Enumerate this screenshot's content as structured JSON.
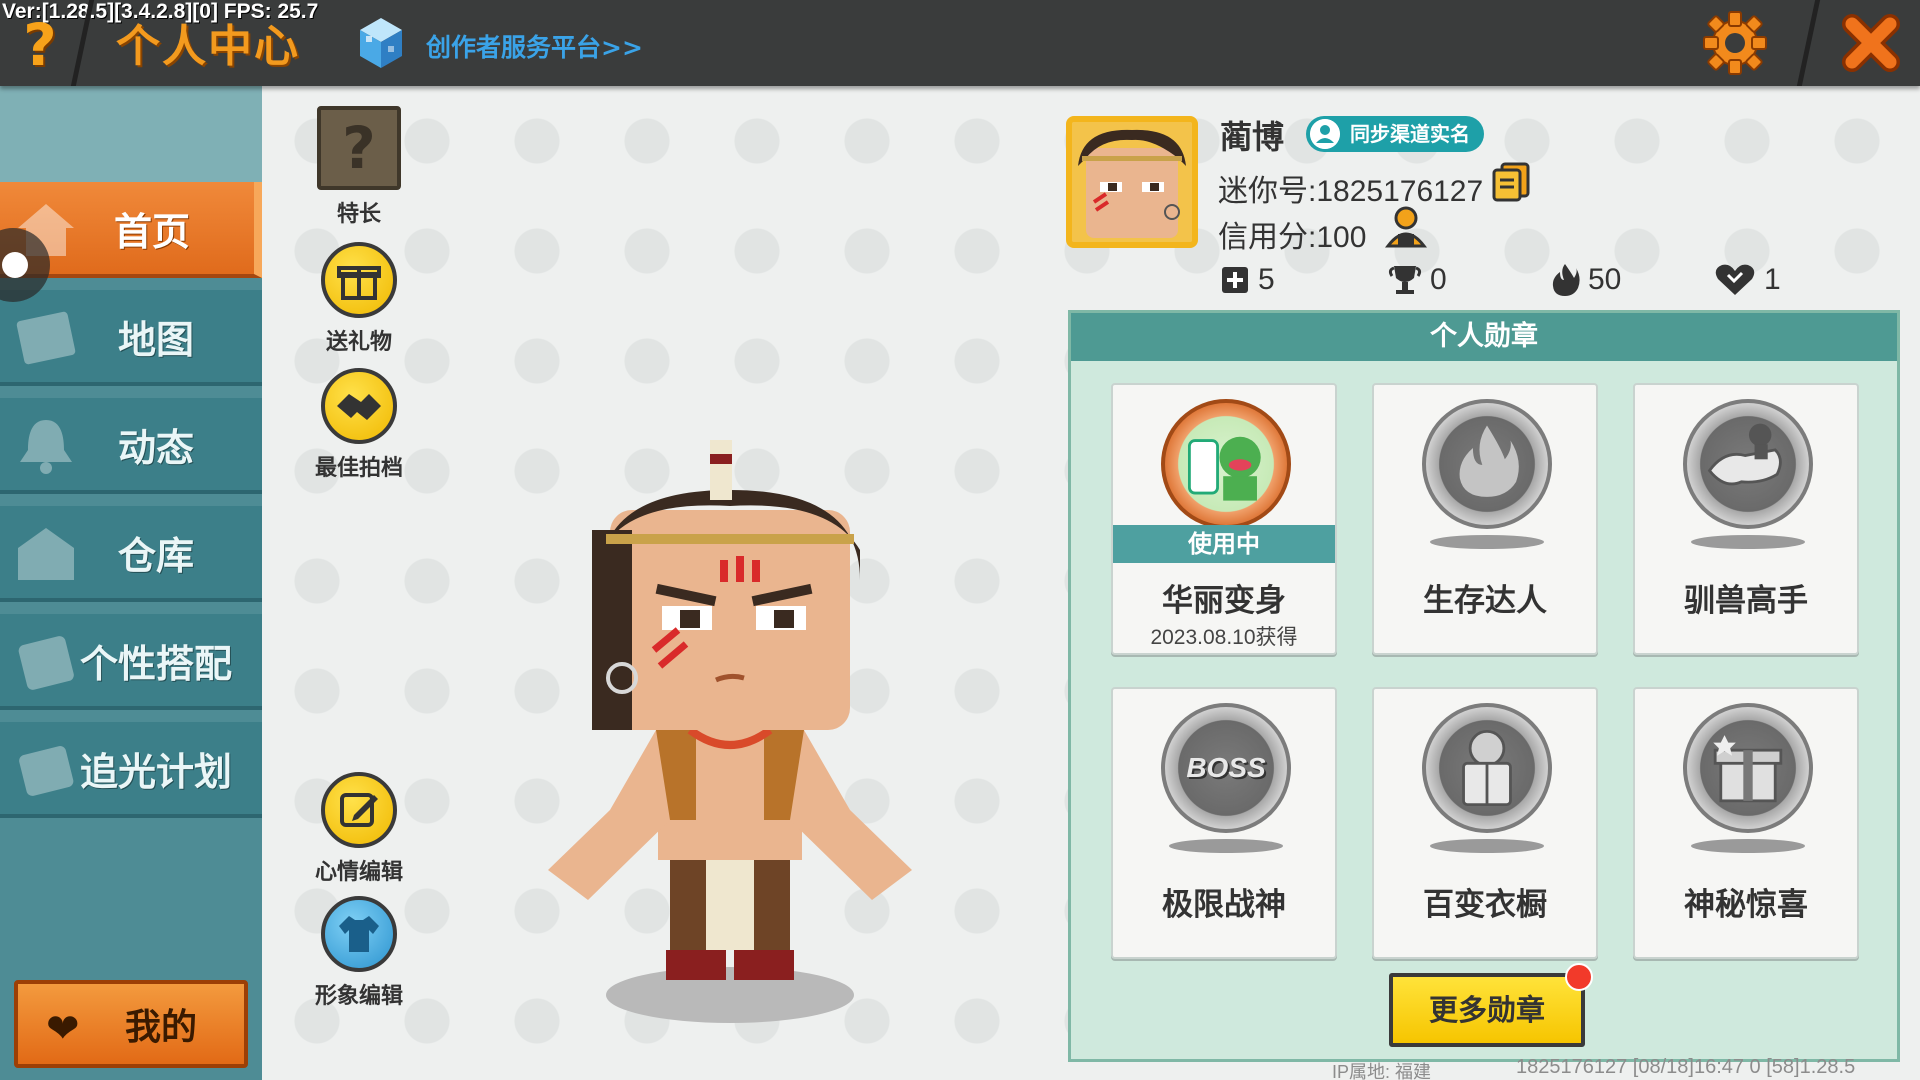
{
  "topbar": {
    "version": "Ver:[1.28.5][3.4.2.8][0] FPS: 25.7",
    "help_symbol": "?",
    "title": "个人中心",
    "creator_link": "创作者服务平台>>"
  },
  "sidebar": {
    "items": [
      {
        "label": "首页",
        "icon": "home-icon",
        "active": true
      },
      {
        "label": "地图",
        "icon": "map-icon",
        "active": false
      },
      {
        "label": "动态",
        "icon": "bell-icon",
        "active": false
      },
      {
        "label": "仓库",
        "icon": "warehouse-icon",
        "active": false
      },
      {
        "label": "个性搭配",
        "icon": "outfit-icon",
        "active": false
      },
      {
        "label": "追光计划",
        "icon": "plan-icon",
        "active": false
      }
    ],
    "mine_label": "我的"
  },
  "actions": {
    "specialty": "特长",
    "gift": "送礼物",
    "partner": "最佳拍档",
    "mood": "心情编辑",
    "appearance": "形象编辑"
  },
  "profile": {
    "nickname": "蔺博",
    "realname_badge": "同步渠道实名",
    "mini_id": "迷你号:1825176127",
    "credit": "信用分:100",
    "stats": {
      "plus": "5",
      "trophy": "0",
      "fire": "50",
      "heart": "1"
    }
  },
  "badges": {
    "header": "个人勋章",
    "in_use": "使用中",
    "items": [
      {
        "name": "华丽变身",
        "date": "2023.08.10获得",
        "active": true
      },
      {
        "name": "生存达人"
      },
      {
        "name": "驯兽高手"
      },
      {
        "name": "极限战神",
        "glyph": "BOSS"
      },
      {
        "name": "百变衣橱"
      },
      {
        "name": "神秘惊喜"
      }
    ],
    "more_label": "更多勋章"
  },
  "footer": {
    "ip": "IP属地: 福建",
    "info": "1825176127 [08/18]16:47 0 [58]1.28.5"
  },
  "colors": {
    "accent_orange": "#e87a2a",
    "sidebar_teal": "#3c7f89",
    "badge_header": "#4e9a93",
    "yellow_button": "#f6c500"
  }
}
